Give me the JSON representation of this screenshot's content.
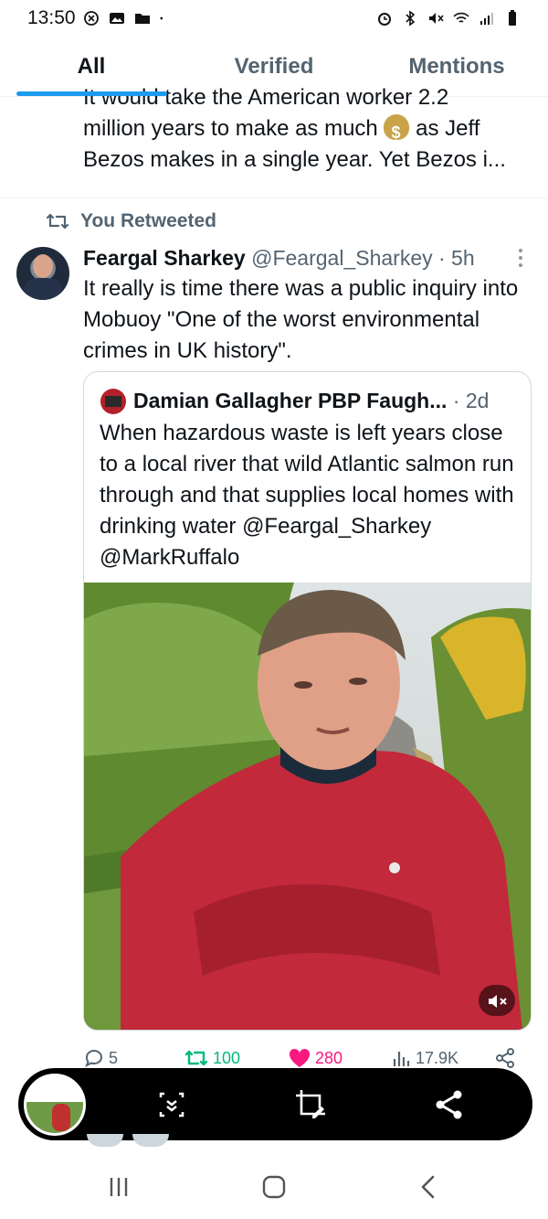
{
  "status_bar": {
    "time": "13:50"
  },
  "tabs": [
    {
      "label": "All",
      "active": true
    },
    {
      "label": "Verified",
      "active": false
    },
    {
      "label": "Mentions",
      "active": false
    }
  ],
  "previous_tweet": {
    "line1": "It would take the American worker 2.2",
    "line2_a": "million years to make as much",
    "line2_b": "as Jeff",
    "line3": "Bezos makes in a single year. Yet Bezos i..."
  },
  "retweet_label": "You Retweeted",
  "tweet": {
    "name": "Feargal Sharkey",
    "handle_time": "@Feargal_Sharkey · 5h",
    "text": "It really is time there was a public inquiry into Mobuoy \"One of the worst environmental crimes in UK history\"."
  },
  "quote": {
    "name": "Damian Gallagher PBP Faugh...",
    "time": " · 2d",
    "text": "When hazardous waste is left years close to a local river that wild Atlantic salmon run through and that supplies local homes with drinking water @Feargal_Sharkey @MarkRuffalo"
  },
  "actions": {
    "replies": "5",
    "retweets": "100",
    "likes": "280",
    "views": "17.9K"
  },
  "colors": {
    "accent": "#1d9bf0",
    "retweet": "#00ba7c",
    "like": "#f91880",
    "muted": "#536471"
  }
}
